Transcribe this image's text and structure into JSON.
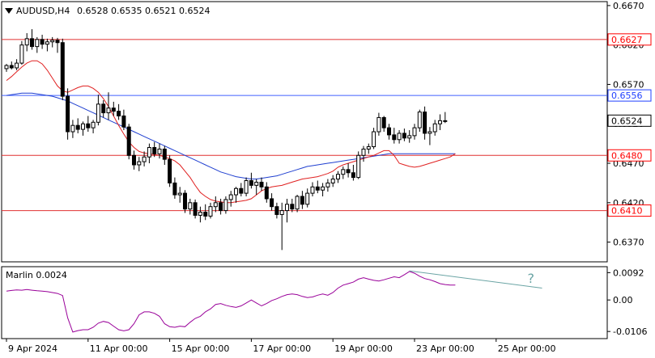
{
  "chart_data": {
    "type": "candlestick",
    "header": {
      "symbol_timeframe": "AUDUSD,H4",
      "ohlc": "0.6528 0.6535 0.6521 0.6524"
    },
    "ylim": [
      0.6345,
      0.6675
    ],
    "price_ticks": [
      "0.6670",
      "0.6620",
      "0.6570",
      "0.6520",
      "0.6470",
      "0.6420",
      "0.6370"
    ],
    "x_ticks": [
      {
        "i": 0,
        "label": "9 Apr 2024"
      },
      {
        "i": 16,
        "label": "11 Apr 00:00"
      },
      {
        "i": 32,
        "label": "15 Apr 00:00"
      },
      {
        "i": 48,
        "label": "17 Apr 00:00"
      },
      {
        "i": 64,
        "label": "19 Apr 00:00"
      },
      {
        "i": 80,
        "label": "23 Apr 00:00"
      },
      {
        "i": 96,
        "label": "25 Apr 00:00"
      }
    ],
    "levels": [
      {
        "value": 0.6627,
        "label": "0.6627",
        "color": "#ff0000",
        "line": "#e03030"
      },
      {
        "value": 0.6556,
        "label": "0.6556",
        "color": "#2040ff",
        "line": "#4060ff"
      },
      {
        "value": 0.648,
        "label": "0.6480",
        "color": "#ff0000",
        "line": "#e03030"
      },
      {
        "value": 0.641,
        "label": "0.6410",
        "color": "#ff0000",
        "line": "#e03030"
      }
    ],
    "current_price": {
      "value": 0.6524,
      "label": "0.6524"
    },
    "candles": [
      [
        0.659,
        0.6596,
        0.6586,
        0.6594
      ],
      [
        0.6594,
        0.6599,
        0.6589,
        0.6591
      ],
      [
        0.6591,
        0.6602,
        0.6588,
        0.6597
      ],
      [
        0.6597,
        0.6625,
        0.6595,
        0.662
      ],
      [
        0.662,
        0.6635,
        0.6612,
        0.6628
      ],
      [
        0.6628,
        0.664,
        0.6614,
        0.6618
      ],
      [
        0.6618,
        0.663,
        0.661,
        0.6627
      ],
      [
        0.6627,
        0.6633,
        0.6615,
        0.6621
      ],
      [
        0.6621,
        0.6628,
        0.6612,
        0.6624
      ],
      [
        0.6624,
        0.663,
        0.6617,
        0.6626
      ],
      [
        0.6626,
        0.6629,
        0.661,
        0.6623
      ],
      [
        0.6623,
        0.6628,
        0.655,
        0.6555
      ],
      [
        0.6555,
        0.6565,
        0.65,
        0.651
      ],
      [
        0.651,
        0.6525,
        0.6502,
        0.6518
      ],
      [
        0.6518,
        0.6527,
        0.6508,
        0.6513
      ],
      [
        0.6513,
        0.6523,
        0.6505,
        0.652
      ],
      [
        0.652,
        0.653,
        0.651,
        0.6515
      ],
      [
        0.6515,
        0.6525,
        0.6508,
        0.6522
      ],
      [
        0.6522,
        0.6557,
        0.6518,
        0.6545
      ],
      [
        0.6545,
        0.655,
        0.6528,
        0.6534
      ],
      [
        0.6534,
        0.656,
        0.6525,
        0.654
      ],
      [
        0.654,
        0.6548,
        0.653,
        0.6536
      ],
      [
        0.6536,
        0.6545,
        0.6525,
        0.653
      ],
      [
        0.653,
        0.6538,
        0.6512,
        0.6516
      ],
      [
        0.6516,
        0.652,
        0.6475,
        0.648
      ],
      [
        0.648,
        0.6486,
        0.6462,
        0.6468
      ],
      [
        0.6468,
        0.6478,
        0.646,
        0.6472
      ],
      [
        0.6472,
        0.6485,
        0.6466,
        0.6478
      ],
      [
        0.6478,
        0.6495,
        0.647,
        0.649
      ],
      [
        0.649,
        0.6497,
        0.6478,
        0.6482
      ],
      [
        0.6482,
        0.6495,
        0.6476,
        0.6488
      ],
      [
        0.6488,
        0.6492,
        0.6468,
        0.6475
      ],
      [
        0.6475,
        0.648,
        0.644,
        0.6445
      ],
      [
        0.6445,
        0.6452,
        0.6425,
        0.643
      ],
      [
        0.643,
        0.644,
        0.642,
        0.6432
      ],
      [
        0.6432,
        0.6436,
        0.6407,
        0.6412
      ],
      [
        0.6412,
        0.6425,
        0.6405,
        0.642
      ],
      [
        0.642,
        0.6424,
        0.64,
        0.6404
      ],
      [
        0.6404,
        0.6415,
        0.6395,
        0.6408
      ],
      [
        0.6408,
        0.6418,
        0.6398,
        0.6403
      ],
      [
        0.6403,
        0.642,
        0.64,
        0.6415
      ],
      [
        0.6415,
        0.6428,
        0.6408,
        0.642
      ],
      [
        0.642,
        0.6425,
        0.6405,
        0.641
      ],
      [
        0.641,
        0.6428,
        0.6406,
        0.6424
      ],
      [
        0.6424,
        0.6435,
        0.6415,
        0.643
      ],
      [
        0.643,
        0.644,
        0.642,
        0.6438
      ],
      [
        0.6438,
        0.6445,
        0.6428,
        0.6432
      ],
      [
        0.6432,
        0.6452,
        0.6428,
        0.6448
      ],
      [
        0.6448,
        0.6458,
        0.6438,
        0.6442
      ],
      [
        0.6442,
        0.645,
        0.643,
        0.6446
      ],
      [
        0.6446,
        0.6452,
        0.6435,
        0.644
      ],
      [
        0.644,
        0.6446,
        0.642,
        0.6425
      ],
      [
        0.6425,
        0.6432,
        0.641,
        0.6415
      ],
      [
        0.6415,
        0.642,
        0.64,
        0.6405
      ],
      [
        0.6405,
        0.642,
        0.636,
        0.641
      ],
      [
        0.641,
        0.6425,
        0.6395,
        0.6418
      ],
      [
        0.6418,
        0.6425,
        0.6408,
        0.6412
      ],
      [
        0.6412,
        0.643,
        0.6408,
        0.6428
      ],
      [
        0.6428,
        0.6435,
        0.6412,
        0.6418
      ],
      [
        0.6418,
        0.6438,
        0.6414,
        0.6432
      ],
      [
        0.6432,
        0.6446,
        0.6428,
        0.644
      ],
      [
        0.644,
        0.6448,
        0.6432,
        0.6436
      ],
      [
        0.6436,
        0.6445,
        0.6428,
        0.644
      ],
      [
        0.644,
        0.645,
        0.6434,
        0.6445
      ],
      [
        0.6445,
        0.6455,
        0.644,
        0.645
      ],
      [
        0.645,
        0.646,
        0.6445,
        0.6456
      ],
      [
        0.6456,
        0.6466,
        0.645,
        0.6462
      ],
      [
        0.6462,
        0.647,
        0.6452,
        0.6458
      ],
      [
        0.6458,
        0.6468,
        0.6448,
        0.6452
      ],
      [
        0.6452,
        0.6485,
        0.645,
        0.648
      ],
      [
        0.648,
        0.6492,
        0.6472,
        0.6488
      ],
      [
        0.6488,
        0.6495,
        0.6482,
        0.6491
      ],
      [
        0.6491,
        0.6515,
        0.6488,
        0.651
      ],
      [
        0.651,
        0.6534,
        0.6505,
        0.6528
      ],
      [
        0.6528,
        0.653,
        0.651,
        0.6515
      ],
      [
        0.6515,
        0.652,
        0.65,
        0.6506
      ],
      [
        0.6506,
        0.6515,
        0.6495,
        0.65
      ],
      [
        0.65,
        0.6512,
        0.6495,
        0.6508
      ],
      [
        0.6508,
        0.6514,
        0.6498,
        0.6502
      ],
      [
        0.6502,
        0.6512,
        0.6496,
        0.6505
      ],
      [
        0.6505,
        0.652,
        0.65,
        0.6515
      ],
      [
        0.6515,
        0.6538,
        0.651,
        0.6535
      ],
      [
        0.6535,
        0.6542,
        0.65,
        0.6508
      ],
      [
        0.6508,
        0.6516,
        0.6493,
        0.651
      ],
      [
        0.651,
        0.6525,
        0.6505,
        0.652
      ],
      [
        0.652,
        0.6532,
        0.6512,
        0.6524
      ],
      [
        0.6524,
        0.6535,
        0.6521,
        0.6524
      ]
    ],
    "sma_red": [
      0.6575,
      0.658,
      0.6586,
      0.6592,
      0.6597,
      0.66,
      0.66,
      0.6596,
      0.6588,
      0.6578,
      0.6568,
      0.6562,
      0.656,
      0.6563,
      0.6566,
      0.6568,
      0.6568,
      0.6565,
      0.656,
      0.6552,
      0.6542,
      0.653,
      0.6518,
      0.6507,
      0.6497,
      0.649,
      0.6485,
      0.6483,
      0.6482,
      0.6481,
      0.648,
      0.6478,
      0.6476,
      0.6473,
      0.6468,
      0.646,
      0.6452,
      0.6442,
      0.6433,
      0.6428,
      0.6424,
      0.6422,
      0.6421,
      0.642,
      0.642,
      0.6421,
      0.6422,
      0.6423,
      0.6425,
      0.643,
      0.6435,
      0.6438,
      0.644,
      0.6441,
      0.6442,
      0.6444,
      0.6446,
      0.6448,
      0.645,
      0.6451,
      0.6452,
      0.6453,
      0.6455,
      0.6457,
      0.646,
      0.6465,
      0.6468,
      0.647,
      0.6472,
      0.6474,
      0.6476,
      0.6478,
      0.648,
      0.6483,
      0.6486,
      0.6486,
      0.648,
      0.647,
      0.6468,
      0.6466,
      0.6465,
      0.6466,
      0.6468,
      0.647,
      0.6472,
      0.6474,
      0.6476,
      0.6478,
      0.6482
    ],
    "sma_blue": [
      0.6556,
      0.6557,
      0.6558,
      0.6559,
      0.6559,
      0.6559,
      0.6558,
      0.6557,
      0.6556,
      0.6555,
      0.6553,
      0.6551,
      0.6549,
      0.6546,
      0.6543,
      0.654,
      0.6537,
      0.6534,
      0.6531,
      0.6528,
      0.6525,
      0.6522,
      0.6519,
      0.6516,
      0.6513,
      0.651,
      0.6507,
      0.6504,
      0.6501,
      0.6498,
      0.6495,
      0.6492,
      0.6489,
      0.6486,
      0.6483,
      0.648,
      0.6477,
      0.6474,
      0.6471,
      0.6468,
      0.6465,
      0.6462,
      0.6459,
      0.6457,
      0.6455,
      0.6453,
      0.6452,
      0.6451,
      0.645,
      0.645,
      0.6451,
      0.6452,
      0.6453,
      0.6454,
      0.6456,
      0.6458,
      0.646,
      0.6462,
      0.6464,
      0.6466,
      0.6467,
      0.6468,
      0.6469,
      0.647,
      0.6471,
      0.6472,
      0.6473,
      0.6474,
      0.6475,
      0.6476,
      0.6477,
      0.6478,
      0.6479,
      0.648,
      0.6481,
      0.6482,
      0.6482,
      0.6482,
      0.6482,
      0.6482,
      0.6482,
      0.6482,
      0.6482,
      0.6482,
      0.6482,
      0.6482,
      0.6482,
      0.6482,
      0.6482
    ],
    "indicator": {
      "label": "Marlin 0.0024",
      "ylim": [
        -0.013,
        0.0112
      ],
      "ticks": [
        "0.0092",
        "0.00",
        "-0.0106"
      ],
      "values": [
        0.003,
        0.0032,
        0.0034,
        0.0033,
        0.0035,
        0.0033,
        0.0031,
        0.003,
        0.0028,
        0.0025,
        0.0022,
        0.0015,
        -0.006,
        -0.0108,
        -0.0103,
        -0.01,
        -0.01,
        -0.0092,
        -0.0078,
        -0.0072,
        -0.0076,
        -0.0088,
        -0.01,
        -0.0104,
        -0.01,
        -0.008,
        -0.005,
        -0.004,
        -0.004,
        -0.0045,
        -0.0055,
        -0.008,
        -0.009,
        -0.0092,
        -0.0088,
        -0.009,
        -0.0075,
        -0.0062,
        -0.0055,
        -0.004,
        -0.003,
        -0.0015,
        -0.0012,
        -0.0018,
        -0.0022,
        -0.0025,
        -0.002,
        -0.001,
        0.0,
        -0.001,
        -0.002,
        -0.0012,
        -0.0002,
        0.0004,
        0.0012,
        0.0018,
        0.002,
        0.0018,
        0.0012,
        0.0008,
        0.001,
        0.0016,
        0.002,
        0.0016,
        0.0025,
        0.004,
        0.005,
        0.0055,
        0.006,
        0.007,
        0.0075,
        0.007,
        0.0066,
        0.0064,
        0.0068,
        0.0073,
        0.0078,
        0.0075,
        0.0085,
        0.0096,
        0.009,
        0.008,
        0.0072,
        0.0068,
        0.0062,
        0.0055,
        0.0052,
        0.005,
        0.005
      ],
      "divergence_label": "?",
      "divergence_line": {
        "from": 79,
        "to": 105,
        "values": [
          0.0098,
          0.004
        ]
      },
      "divergence_color": "#6aa4a4"
    }
  }
}
